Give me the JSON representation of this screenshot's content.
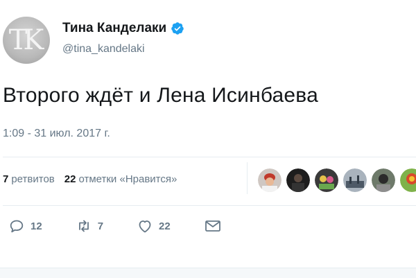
{
  "author": {
    "name": "Тина Канделаки",
    "handle": "@tina_kandelaki",
    "avatar_monogram": "TK",
    "verified": true
  },
  "tweet": {
    "text": "Второго ждёт и Лена Исинбаева",
    "timestamp": "1:09 - 31 июл. 2017 г."
  },
  "stats": {
    "retweets_count": "7",
    "retweets_label": "ретвитов",
    "likes_count": "22",
    "likes_label": "отметки «Нравится»"
  },
  "actions": {
    "reply_count": "12",
    "retweet_count": "7",
    "like_count": "22"
  },
  "colors": {
    "verified_blue": "#1da1f2",
    "text_primary": "#14171a",
    "text_secondary": "#657786",
    "divider": "#e6ecf0"
  }
}
